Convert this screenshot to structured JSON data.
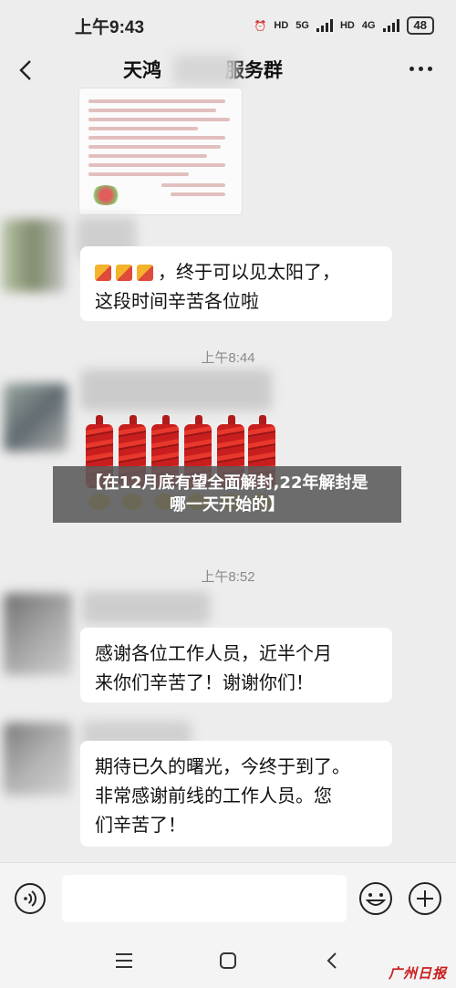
{
  "status_bar": {
    "time": "上午9:43",
    "network1": "5G",
    "network2": "4G",
    "hd_label": "HD",
    "battery": "48"
  },
  "header": {
    "title_left": "天鸿",
    "title_right": "服务群"
  },
  "messages": {
    "m1_text_line1": "，终于可以见太阳了，",
    "m1_text_line2": "这段时间辛苦各位啦",
    "time1": "上午8:44",
    "time2": "上午8:52",
    "m3_line1": "感谢各位工作人员，近半个月",
    "m3_line2": "来你们辛苦了！谢谢你们！",
    "m4_line1": "期待已久的曙光，今终于到了。",
    "m4_line2": "非常感谢前线的工作人员。您",
    "m4_line3": "们辛苦了！"
  },
  "overlay": {
    "headline_line1": "【在12月底有望全面解封,22年解封是",
    "headline_line2": "哪一天开始的】"
  },
  "input_bar": {
    "placeholder": ""
  },
  "watermark": "广州日报",
  "colors": {
    "background": "#ededed",
    "bubble": "#ffffff",
    "overlay": "#5a5a5a",
    "watermark": "#c91d1d"
  }
}
